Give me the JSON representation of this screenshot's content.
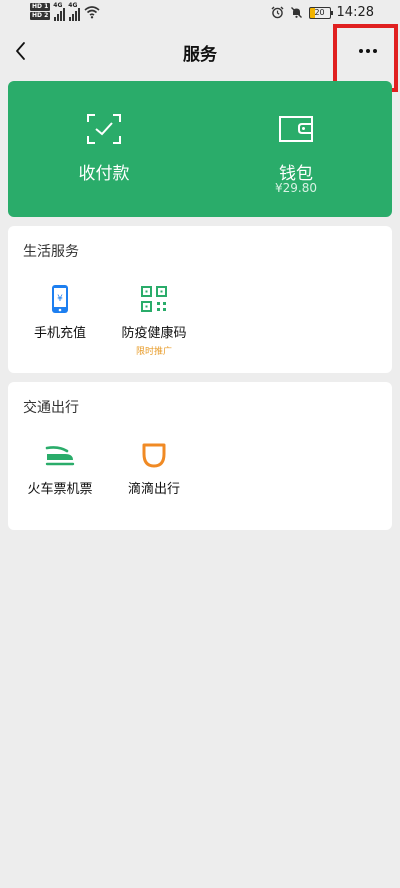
{
  "status_bar": {
    "hd1": "HD 1",
    "hd2": "HD 2",
    "net1": "4G",
    "net2": "4G",
    "battery": "20",
    "time": "14:28"
  },
  "nav": {
    "title": "服务"
  },
  "pay_card": {
    "collect_label": "收付款",
    "wallet_label": "钱包",
    "wallet_balance": "¥29.80"
  },
  "life_services": {
    "title": "生活服务",
    "items": [
      {
        "label": "手机充值",
        "icon": "phone-recharge-icon"
      },
      {
        "label": "防疫健康码",
        "icon": "qr-code-icon",
        "promo": "限时推广"
      }
    ]
  },
  "travel": {
    "title": "交通出行",
    "items": [
      {
        "label": "火车票机票",
        "icon": "train-icon"
      },
      {
        "label": "滴滴出行",
        "icon": "didi-icon"
      }
    ]
  },
  "colors": {
    "brand_green": "#2aac6a",
    "background": "#ededed",
    "promo": "#e89c2a",
    "highlight": "#e02020"
  }
}
